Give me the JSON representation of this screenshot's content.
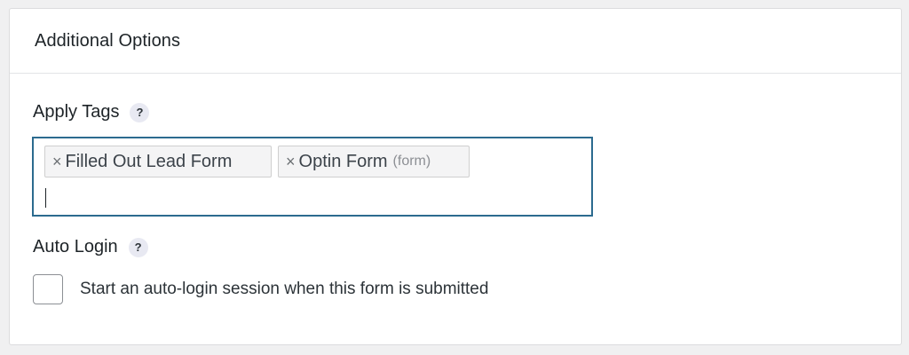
{
  "panel": {
    "title": "Additional Options"
  },
  "apply_tags": {
    "label": "Apply Tags",
    "help": "?",
    "tags": [
      {
        "remove": "×",
        "label": "Filled Out Lead Form",
        "sub": ""
      },
      {
        "remove": "×",
        "label": "Optin Form",
        "sub": "(form)"
      }
    ]
  },
  "auto_login": {
    "label": "Auto Login",
    "help": "?",
    "checkbox_label": "Start an auto-login session when this form is submitted",
    "checked": false
  },
  "colors": {
    "focus_border": "#2c6b8f",
    "panel_bg": "#ffffff",
    "page_bg": "#f0f0f1"
  }
}
